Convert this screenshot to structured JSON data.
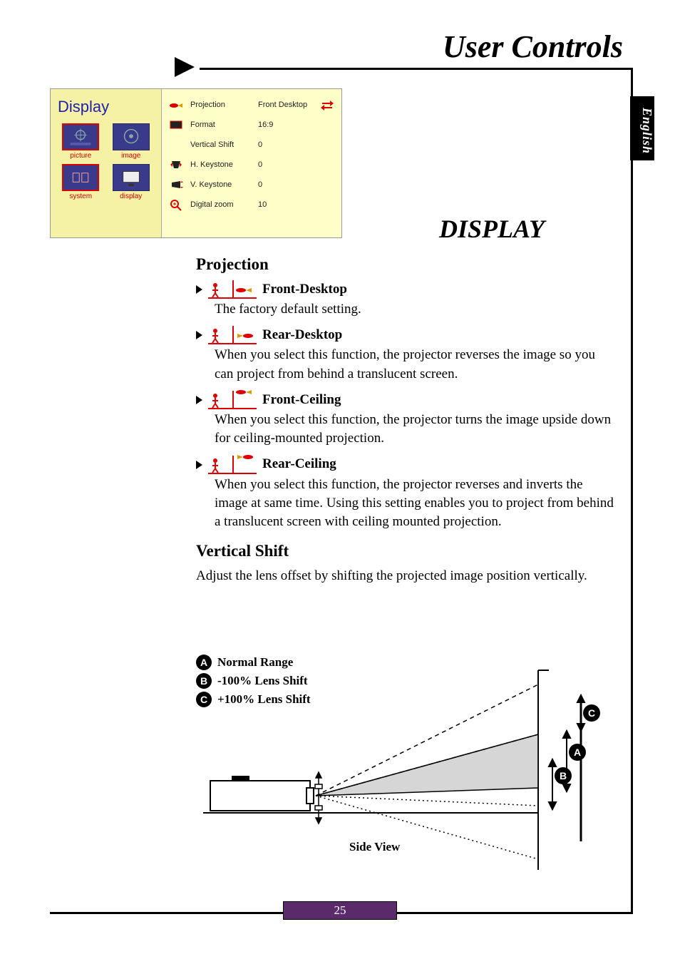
{
  "page_title": "User Controls",
  "language_tab": "English",
  "section_title": "DISPLAY",
  "page_number": "25",
  "osd": {
    "title": "Display",
    "nav": [
      {
        "key": "picture",
        "label": "picture"
      },
      {
        "key": "image",
        "label": "image"
      },
      {
        "key": "system",
        "label": "system"
      },
      {
        "key": "display",
        "label": "display"
      }
    ],
    "rows": [
      {
        "label": "Projection",
        "value": "Front Desktop"
      },
      {
        "label": "Format",
        "value": "16:9"
      },
      {
        "label": "Vertical Shift",
        "value": "0"
      },
      {
        "label": "H. Keystone",
        "value": "0"
      },
      {
        "label": "V. Keystone",
        "value": "0"
      },
      {
        "label": "Digital zoom",
        "value": "10"
      }
    ]
  },
  "projection": {
    "heading": "Projection",
    "modes": [
      {
        "name": "Front-Desktop",
        "desc": "The factory default setting."
      },
      {
        "name": "Rear-Desktop",
        "desc": "When you select this function, the projector reverses the image so you can project from behind a translucent screen."
      },
      {
        "name": "Front-Ceiling",
        "desc": "When you select this function, the projector turns the image upside down for ceiling-mounted projection."
      },
      {
        "name": "Rear-Ceiling",
        "desc": "When you select this function, the projector reverses and inverts the image at same time. Using this setting enables you to project from behind a translucent screen with ceiling mounted projection."
      }
    ]
  },
  "vertical_shift": {
    "heading": "Vertical Shift",
    "desc": "Adjust the lens offset by shifting the projected image position vertically."
  },
  "legend": {
    "a": {
      "letter": "A",
      "text": "Normal Range"
    },
    "b": {
      "letter": "B",
      "text": "-100% Lens Shift"
    },
    "c": {
      "letter": "C",
      "text": "+100% Lens Shift"
    },
    "diagram_label": "Side View",
    "marker_a": "A",
    "marker_b": "B",
    "marker_c": "C"
  }
}
